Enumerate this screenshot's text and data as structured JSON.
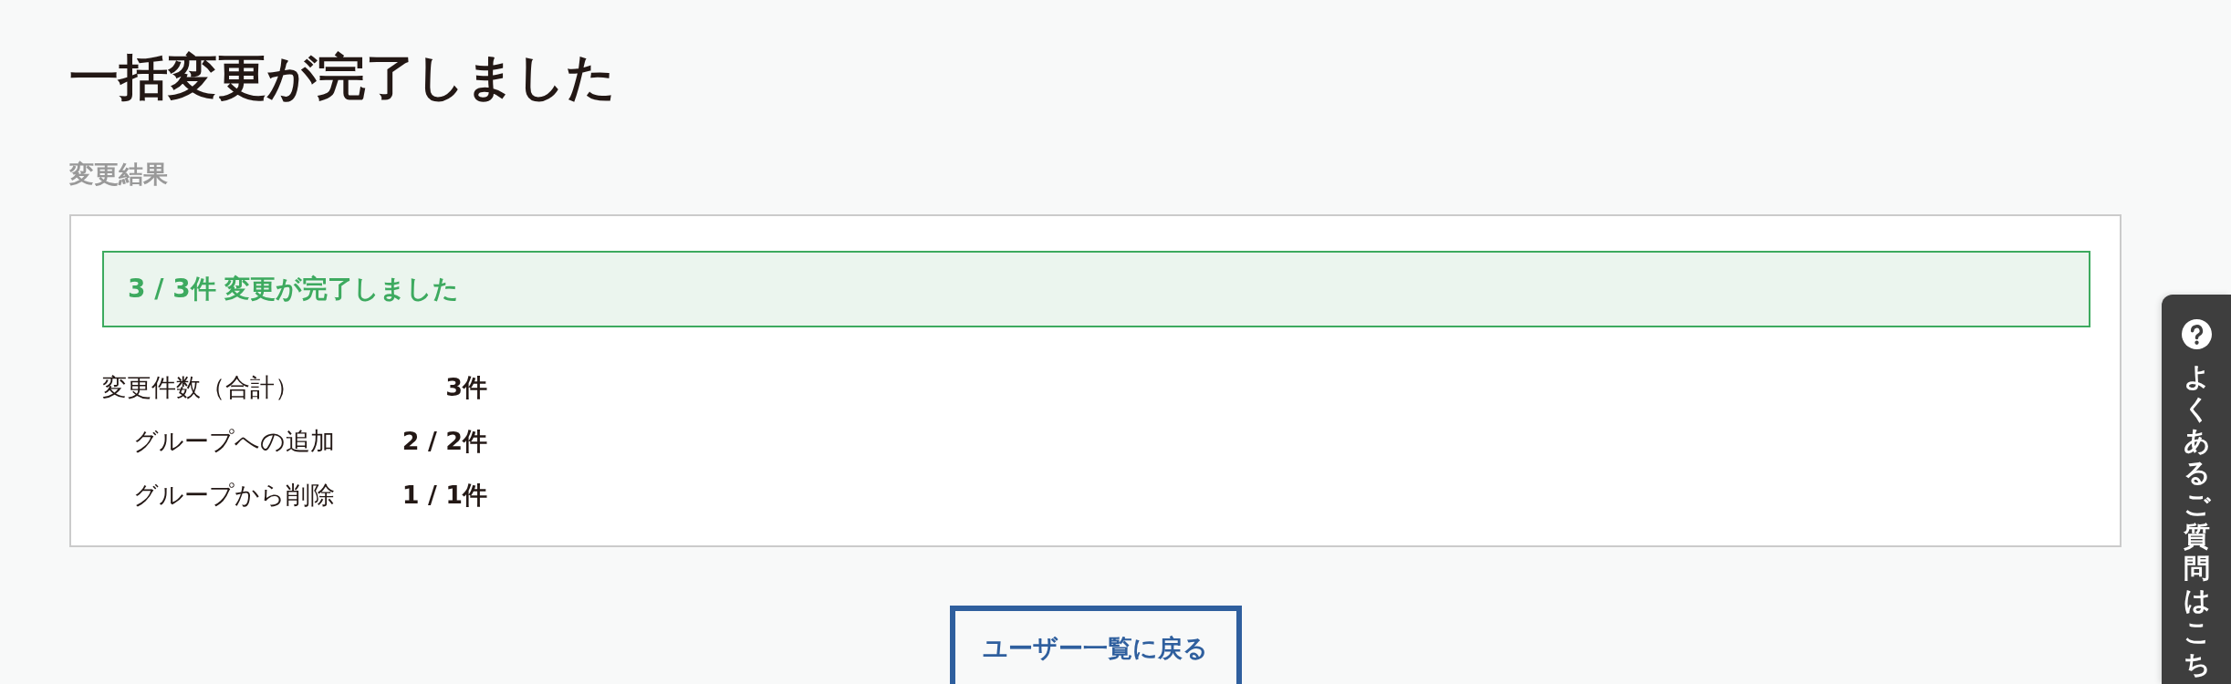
{
  "page": {
    "title": "一括変更が完了しました"
  },
  "result_section": {
    "heading": "変更結果",
    "alert": {
      "kind": "success",
      "message": "3 / 3件 変更が完了しました"
    },
    "summary": [
      {
        "label": "変更件数（合計）",
        "value": "3件",
        "children": [
          {
            "label": "グループへの追加",
            "value": "2 / 2件"
          },
          {
            "label": "グループから削除",
            "value": "1 / 1件"
          }
        ]
      }
    ]
  },
  "back_button": {
    "label": "ユーザー一覧に戻る"
  },
  "faq_tab": {
    "label": "よくあるご質問はこち"
  }
}
